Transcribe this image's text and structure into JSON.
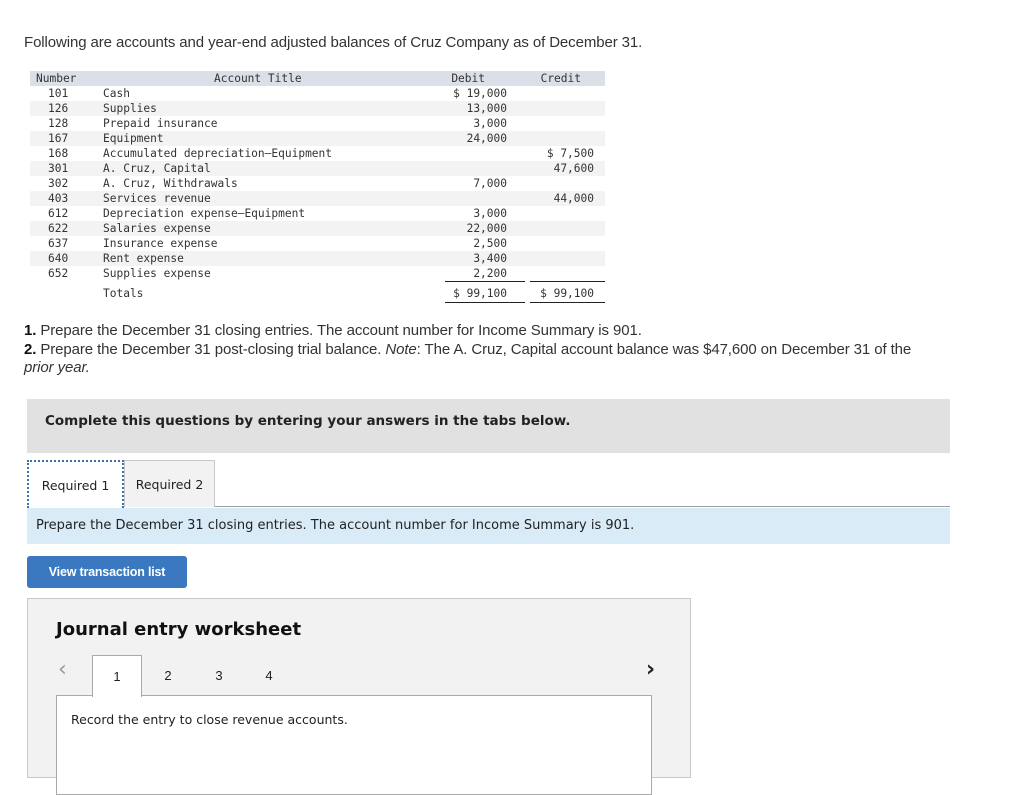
{
  "intro": "Following are accounts and year-end adjusted balances of Cruz Company as of December 31.",
  "trial_balance": {
    "headers": {
      "number": "Number",
      "title": "Account Title",
      "debit": "Debit",
      "credit": "Credit"
    },
    "rows": [
      {
        "number": "101",
        "title": "Cash",
        "debit": "$ 19,000",
        "credit": ""
      },
      {
        "number": "126",
        "title": "Supplies",
        "debit": "13,000",
        "credit": ""
      },
      {
        "number": "128",
        "title": "Prepaid insurance",
        "debit": "3,000",
        "credit": ""
      },
      {
        "number": "167",
        "title": "Equipment",
        "debit": "24,000",
        "credit": ""
      },
      {
        "number": "168",
        "title": "Accumulated depreciation—Equipment",
        "debit": "",
        "credit": "$ 7,500"
      },
      {
        "number": "301",
        "title": "A. Cruz, Capital",
        "debit": "",
        "credit": "47,600"
      },
      {
        "number": "302",
        "title": "A. Cruz, Withdrawals",
        "debit": "7,000",
        "credit": ""
      },
      {
        "number": "403",
        "title": "Services revenue",
        "debit": "",
        "credit": "44,000"
      },
      {
        "number": "612",
        "title": "Depreciation expense—Equipment",
        "debit": "3,000",
        "credit": ""
      },
      {
        "number": "622",
        "title": "Salaries expense",
        "debit": "22,000",
        "credit": ""
      },
      {
        "number": "637",
        "title": "Insurance expense",
        "debit": "2,500",
        "credit": ""
      },
      {
        "number": "640",
        "title": "Rent expense",
        "debit": "3,400",
        "credit": ""
      },
      {
        "number": "652",
        "title": "Supplies expense",
        "debit": "2,200",
        "credit": ""
      }
    ],
    "totals": {
      "label": "Totals",
      "debit": "$ 99,100",
      "credit": "$ 99,100"
    }
  },
  "questions": {
    "q1_num": "1.",
    "q1_text": " Prepare the December 31 closing entries. The account number for Income Summary is 901.",
    "q2_num": "2.",
    "q2_text": " Prepare the December 31 post-closing trial balance. ",
    "q2_note_label": "Note",
    "q2_note_text": ": The A. Cruz, Capital account balance was $47,600 on December 31 of the",
    "q2_note_cont": "prior year."
  },
  "banner": "Complete this questions by entering your answers in the tabs below.",
  "tabs": [
    {
      "label": "Required 1",
      "active": true
    },
    {
      "label": "Required 2",
      "active": false
    }
  ],
  "instruction": "Prepare the December 31 closing entries. The account number for Income Summary is 901.",
  "view_transaction_button": "View transaction list",
  "worksheet": {
    "title": "Journal entry worksheet",
    "prev_icon": "‹",
    "next_icon": "›",
    "pages": [
      "1",
      "2",
      "3",
      "4"
    ],
    "active_page": "1",
    "entry_instruction": "Record the entry to close revenue accounts."
  }
}
